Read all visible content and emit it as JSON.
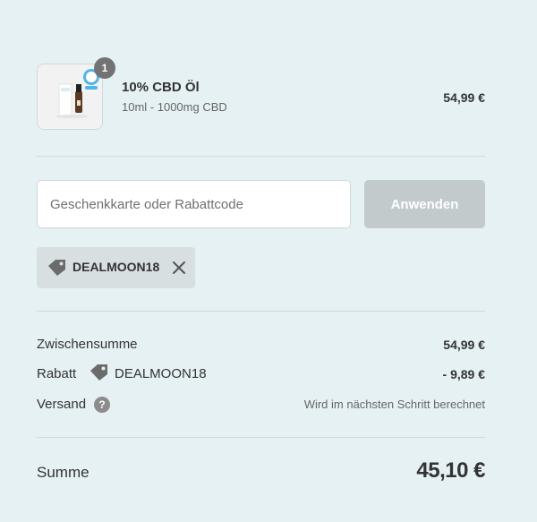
{
  "product": {
    "quantity": "1",
    "name": "10% CBD Öl",
    "variant": "10ml - 1000mg CBD",
    "price": "54,99 €"
  },
  "discount_form": {
    "placeholder": "Geschenkkarte oder Rabattcode",
    "apply_label": "Anwenden"
  },
  "applied_code": {
    "code": "DEALMOON18"
  },
  "summary": {
    "subtotal_label": "Zwischensumme",
    "subtotal_value": "54,99 €",
    "discount_label": "Rabatt",
    "discount_code": "DEALMOON18",
    "discount_value": "- 9,89 €",
    "shipping_label": "Versand",
    "shipping_help": "?",
    "shipping_value": "Wird im nächsten Schritt berechnet",
    "total_label": "Summe",
    "total_value": "45,10 €"
  },
  "colors": {
    "background": "#e6f1f3",
    "button_disabled": "#c2cacc",
    "chip_background": "#d7dfe1",
    "badge": "#737373"
  }
}
